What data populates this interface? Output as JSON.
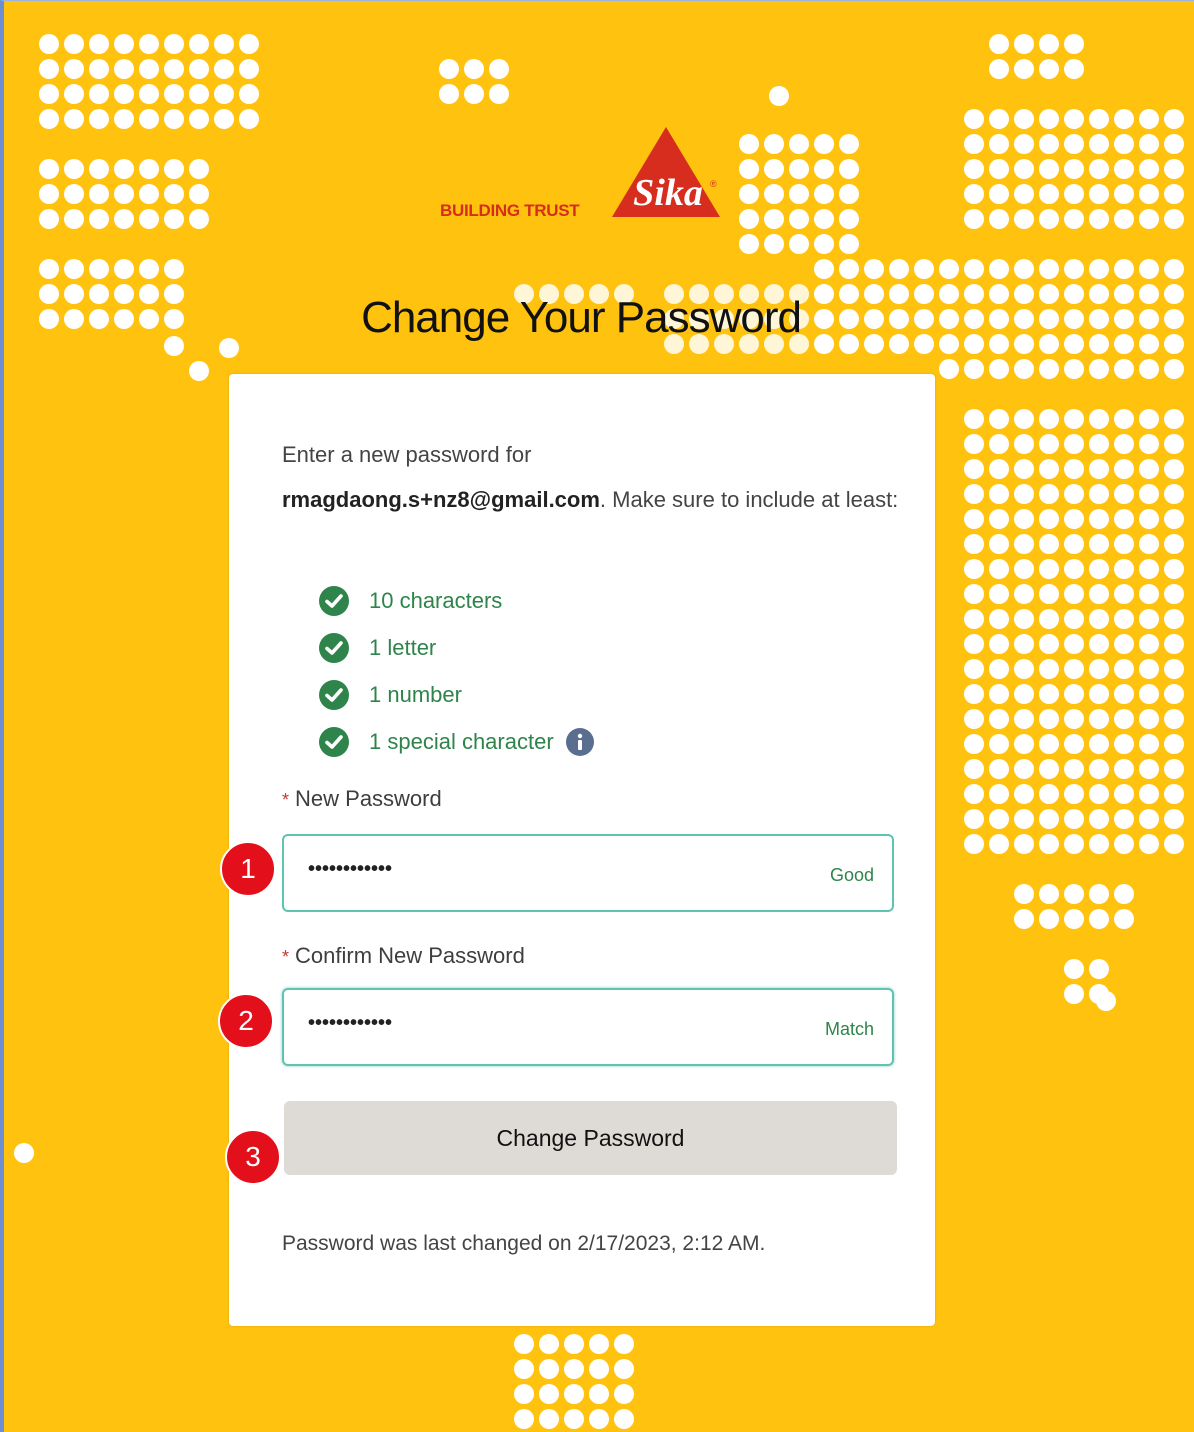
{
  "brand": {
    "tagline": "BUILDING TRUST",
    "logo_text": "Sika",
    "colors": {
      "background": "#FFC20E",
      "logo_red": "#D62D1E"
    }
  },
  "page": {
    "title": "Change Your Password"
  },
  "form": {
    "intro_prefix": "Enter a new password for",
    "email": "rmagdaong.s+nz8@gmail.com",
    "intro_suffix": ". Make sure to include at least:",
    "requirements": [
      {
        "label": "10 characters",
        "met": true
      },
      {
        "label": "1 letter",
        "met": true
      },
      {
        "label": "1 number",
        "met": true
      },
      {
        "label": "1 special character",
        "met": true
      }
    ],
    "new_password": {
      "label": "New Password",
      "required_mark": "*",
      "value": "••••••••••••",
      "strength": "Good"
    },
    "confirm_password": {
      "label": "Confirm New Password",
      "required_mark": "*",
      "value": "••••••••••••",
      "status": "Match"
    },
    "submit_label": "Change Password",
    "last_changed_note": "Password was last changed on 2/17/2023, 2:12 AM."
  },
  "annotations": {
    "markers": [
      "1",
      "2",
      "3"
    ],
    "color": "#e3101b"
  }
}
